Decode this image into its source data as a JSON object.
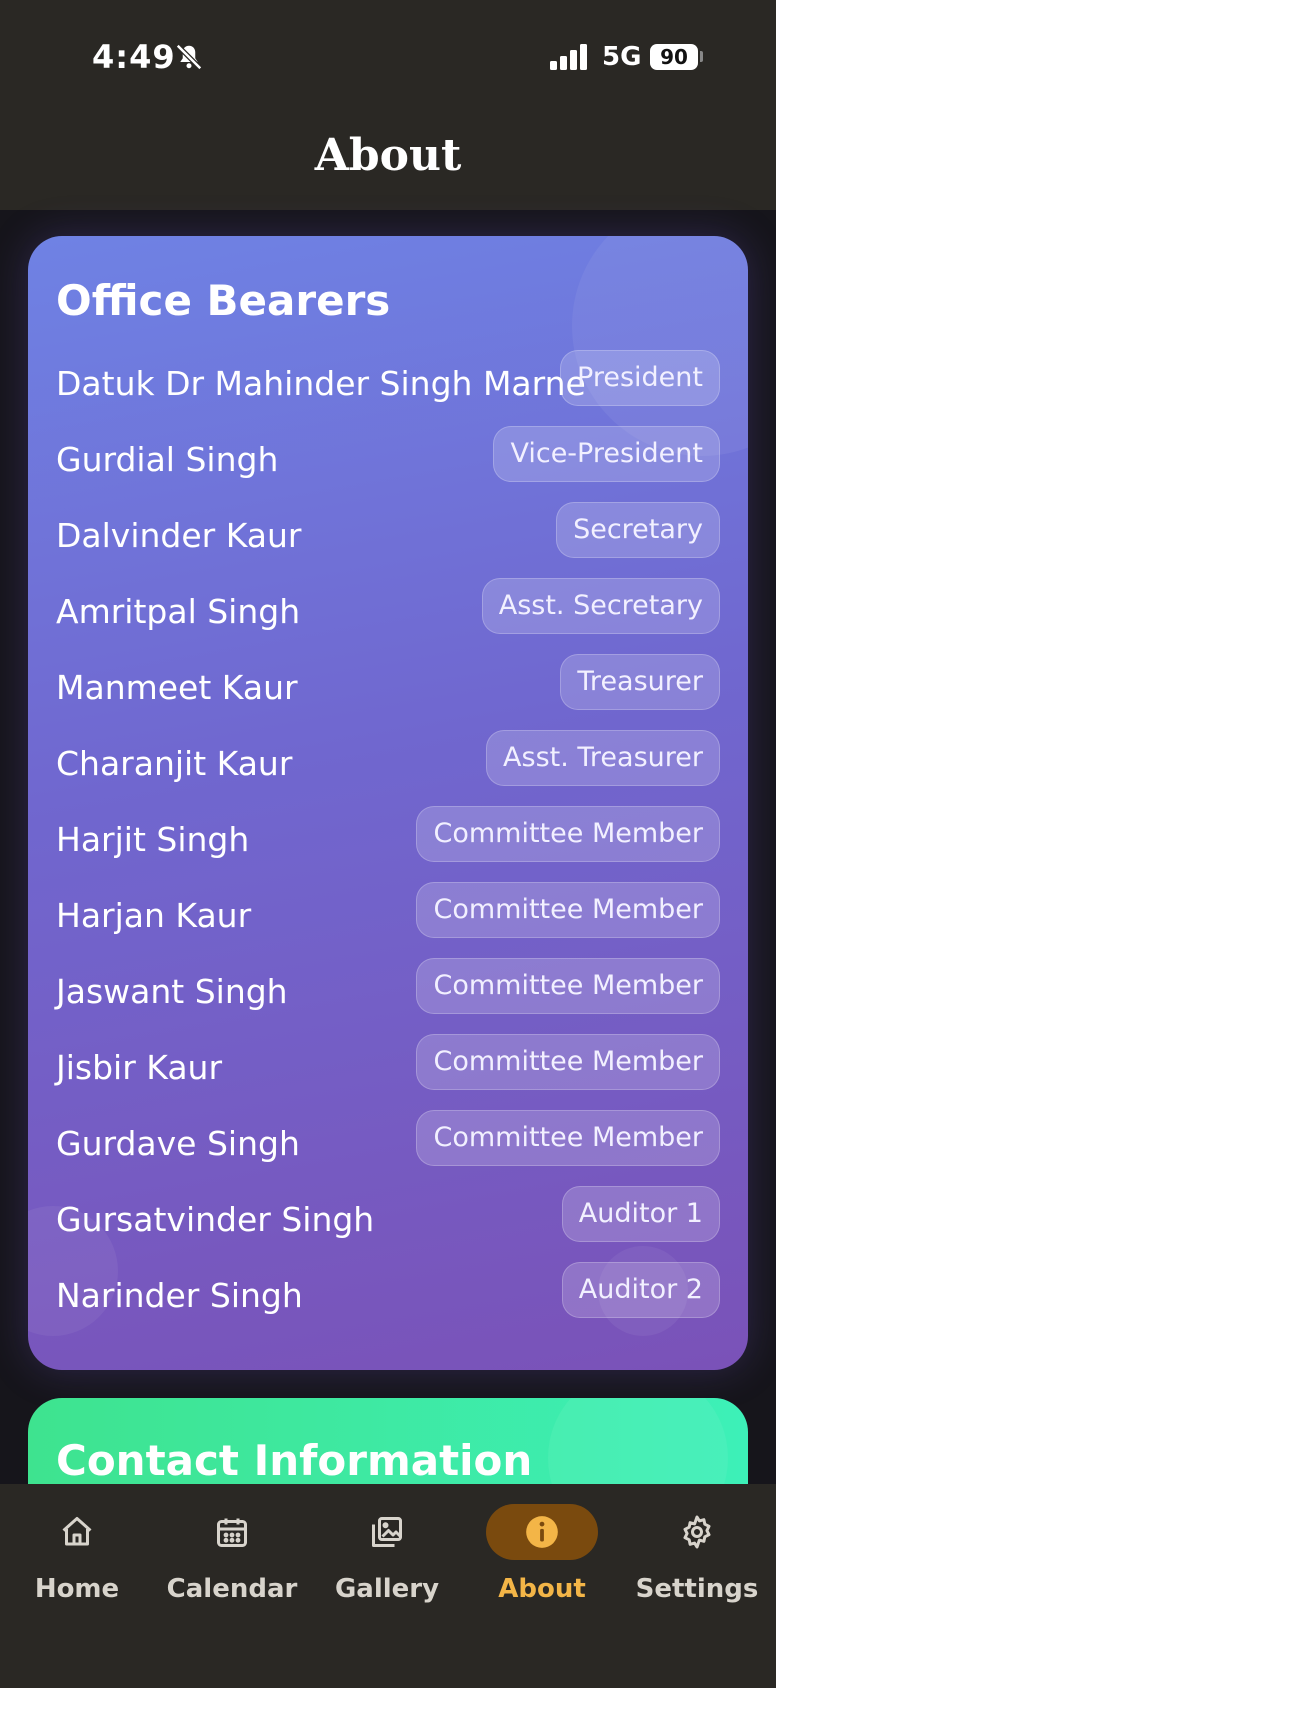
{
  "status_bar": {
    "time": "4:49",
    "network": "5G",
    "battery": "90"
  },
  "header": {
    "title": "About"
  },
  "office_bearers": {
    "title": "Office Bearers",
    "members": [
      {
        "name": "Datuk Dr Mahinder Singh Marne",
        "role": "President"
      },
      {
        "name": "Gurdial Singh",
        "role": "Vice-President"
      },
      {
        "name": "Dalvinder Kaur",
        "role": "Secretary"
      },
      {
        "name": "Amritpal Singh",
        "role": "Asst. Secretary"
      },
      {
        "name": "Manmeet Kaur",
        "role": "Treasurer"
      },
      {
        "name": "Charanjit Kaur",
        "role": "Asst. Treasurer"
      },
      {
        "name": "Harjit Singh",
        "role": "Committee Member"
      },
      {
        "name": "Harjan Kaur",
        "role": "Committee Member"
      },
      {
        "name": "Jaswant Singh",
        "role": "Committee Member"
      },
      {
        "name": "Jisbir Kaur",
        "role": "Committee Member"
      },
      {
        "name": "Gurdave Singh",
        "role": "Committee Member"
      },
      {
        "name": "Gursatvinder Singh",
        "role": "Auditor 1"
      },
      {
        "name": "Narinder Singh",
        "role": "Auditor 2"
      }
    ]
  },
  "contact": {
    "title": "Contact Information"
  },
  "nav": {
    "items": [
      {
        "label": "Home",
        "icon": "home-icon"
      },
      {
        "label": "Calendar",
        "icon": "calendar-icon"
      },
      {
        "label": "Gallery",
        "icon": "gallery-icon"
      },
      {
        "label": "About",
        "icon": "info-icon",
        "active": true
      },
      {
        "label": "Settings",
        "icon": "gear-icon"
      }
    ]
  },
  "colors": {
    "header_bg": "#2a2824",
    "card_gradient_start": "#6f82e4",
    "card_gradient_end": "#7a52b8",
    "contact_gradient_start": "#3ee38f",
    "contact_gradient_end": "#3df0b8",
    "active_nav": "#f3b547"
  }
}
